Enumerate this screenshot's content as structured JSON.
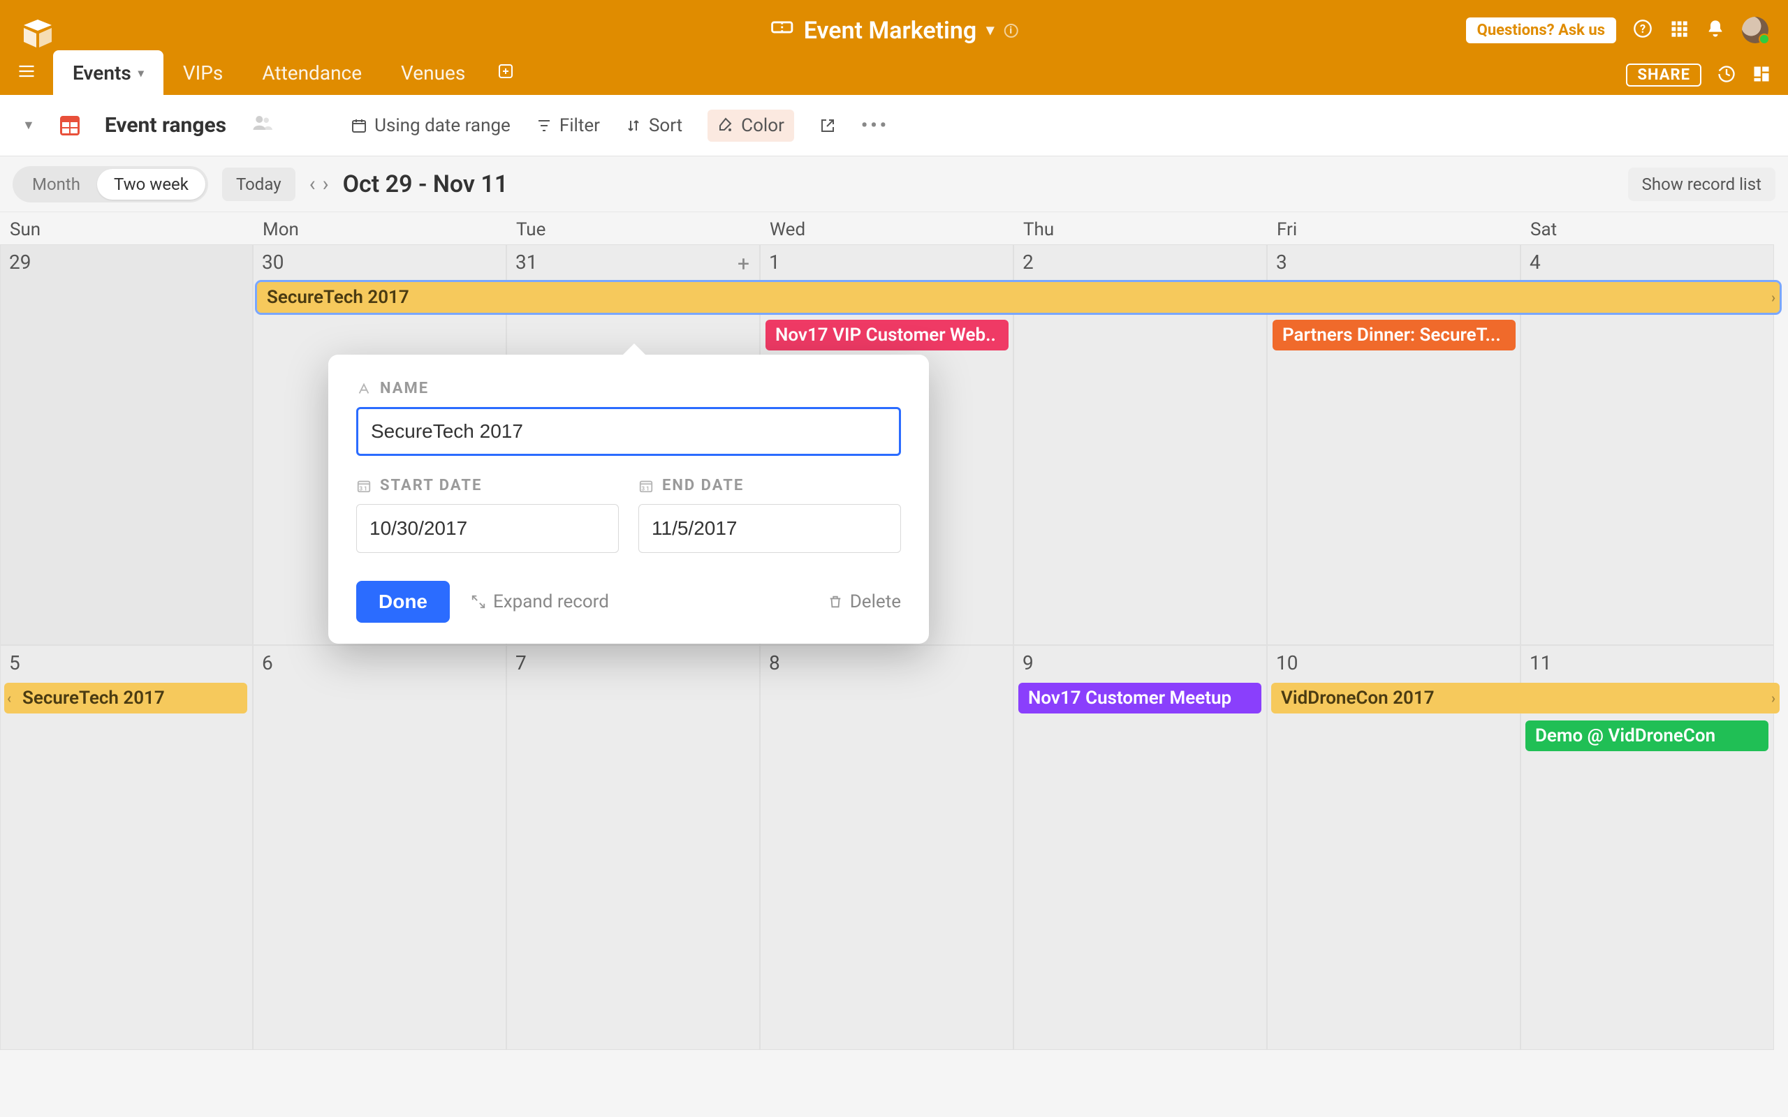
{
  "brand": {
    "accent": "#e08c00"
  },
  "header": {
    "workspace_title": "Event Marketing",
    "questions_label": "Questions? Ask us"
  },
  "tabs": {
    "items": [
      "Events",
      "VIPs",
      "Attendance",
      "Venues"
    ],
    "active_index": 0,
    "share_label": "SHARE"
  },
  "toolbar": {
    "view_name": "Event ranges",
    "using_label": "Using date range",
    "filter_label": "Filter",
    "sort_label": "Sort",
    "color_label": "Color"
  },
  "calendar_controls": {
    "segments": [
      "Month",
      "Two week"
    ],
    "active_segment": 1,
    "today_label": "Today",
    "range_title": "Oct 29 - Nov 11",
    "show_list_label": "Show record list"
  },
  "days_of_week": [
    "Sun",
    "Mon",
    "Tue",
    "Wed",
    "Thu",
    "Fri",
    "Sat"
  ],
  "weeks": [
    {
      "nums": [
        "29",
        "30",
        "31",
        "1",
        "2",
        "3",
        "4"
      ]
    },
    {
      "nums": [
        "5",
        "6",
        "7",
        "8",
        "9",
        "10",
        "11"
      ]
    }
  ],
  "events": {
    "w1_securetech": "SecureTech 2017",
    "w1_vip": "Nov17 VIP Customer Web..",
    "w1_partners": "Partners Dinner: SecureT...",
    "w2_securetech": "SecureTech 2017",
    "w2_meetup": "Nov17 Customer Meetup",
    "w2_viddrone": "VidDroneCon 2017",
    "w2_demo": "Demo @ VidDroneCon"
  },
  "popover": {
    "name_label": "NAME",
    "name_value": "SecureTech 2017",
    "start_label": "START DATE",
    "start_value": "10/30/2017",
    "end_label": "END DATE",
    "end_value": "11/5/2017",
    "done_label": "Done",
    "expand_label": "Expand record",
    "delete_label": "Delete"
  }
}
